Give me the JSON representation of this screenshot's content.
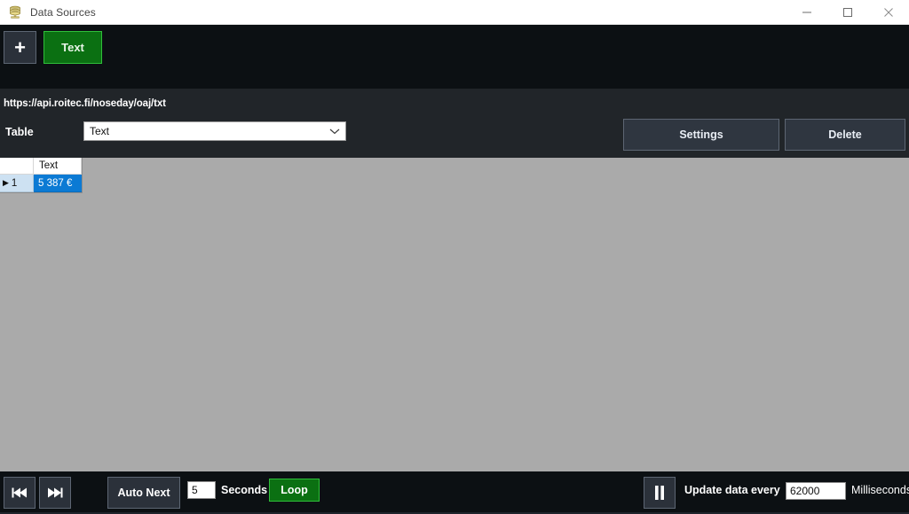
{
  "window": {
    "title": "Data Sources",
    "icon": "database-stack-icon",
    "controls": {
      "minimize": "minimize-icon",
      "maximize": "maximize-icon",
      "close": "close-icon"
    }
  },
  "toolbar": {
    "add_label": "+",
    "sources": [
      {
        "label": "Text",
        "active": true,
        "color": "#0b7012",
        "border": "#2fbf3a"
      }
    ]
  },
  "source_panel": {
    "url": "https://api.roitec.fi/noseday/oaj/txt",
    "table_label": "Table",
    "table_selected": "Text",
    "table_options": [
      "Text"
    ],
    "settings_label": "Settings",
    "delete_label": "Delete"
  },
  "grid": {
    "columns": [
      "",
      "Text"
    ],
    "rows": [
      {
        "header": "1",
        "selected": true,
        "cells": [
          "5 387 €"
        ]
      }
    ],
    "selection_color": "#0b7ad4",
    "row_header_color": "#cde1f2"
  },
  "bottom_bar": {
    "skip_back_icon": "skip-back-icon",
    "skip_forward_icon": "skip-forward-icon",
    "auto_next_label": "Auto Next",
    "seconds_value": "5",
    "seconds_label": "Seconds",
    "loop_label": "Loop",
    "pause_icon": "pause-icon",
    "update_label": "Update data every",
    "update_value": "62000",
    "update_unit": "Milliseconds"
  }
}
